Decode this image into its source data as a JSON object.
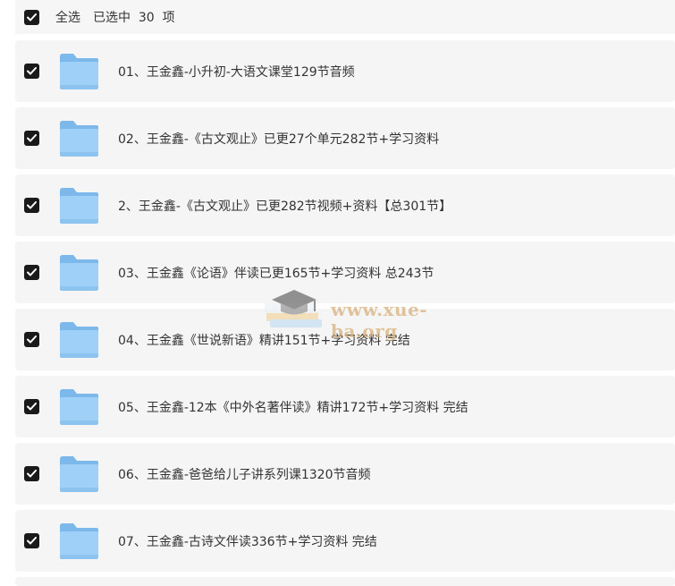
{
  "header": {
    "checked": true,
    "select_all_label": "全选",
    "selected_text": "已选中  30  项"
  },
  "files": [
    {
      "name": "01、王金鑫-小升初-大语文课堂129节音频",
      "checked": true,
      "icon": "folder-icon"
    },
    {
      "name": "02、王金鑫-《古文观止》已更27个单元282节+学习资料",
      "checked": true,
      "icon": "folder-icon"
    },
    {
      "name": "2、王金鑫-《古文观止》已更282节视频+资料【总301节】",
      "checked": true,
      "icon": "folder-icon"
    },
    {
      "name": "03、王金鑫《论语》伴读已更165节+学习资料  总243节",
      "checked": true,
      "icon": "folder-icon"
    },
    {
      "name": "04、王金鑫《世说新语》精讲151节+学习资料 完结",
      "checked": true,
      "icon": "folder-icon"
    },
    {
      "name": "05、王金鑫-12本《中外名著伴读》精讲172节+学习资料 完结",
      "checked": true,
      "icon": "folder-icon"
    },
    {
      "name": "06、王金鑫-爸爸给儿子讲系列课1320节音频",
      "checked": true,
      "icon": "folder-icon"
    },
    {
      "name": "07、王金鑫-古诗文伴读336节+学习资料 完结",
      "checked": true,
      "icon": "folder-icon"
    }
  ],
  "watermark": {
    "text": "www.xue-ba.org"
  },
  "colors": {
    "row_background": "#f5f5f6",
    "checkbox": "#1a1a1a",
    "folder": "#8ec5f3",
    "watermark": "#d9b27c"
  }
}
